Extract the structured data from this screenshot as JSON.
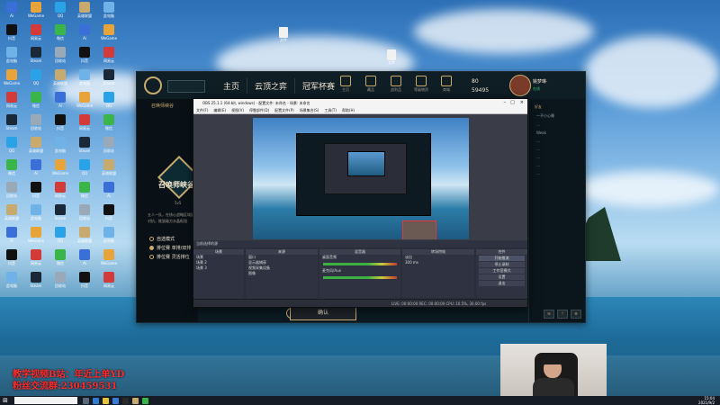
{
  "desktop": {
    "icons": [
      {
        "label": "Ai",
        "color": "#3b6fd8"
      },
      {
        "label": "抖音",
        "color": "#111111"
      },
      {
        "label": "此电脑",
        "color": "#6fb2e8"
      },
      {
        "label": "WeGame",
        "color": "#e8a43a"
      },
      {
        "label": "网易云",
        "color": "#d33a3a"
      },
      {
        "label": "Steam",
        "color": "#1b2838"
      },
      {
        "label": "QQ",
        "color": "#2aa2e8"
      },
      {
        "label": "微信",
        "color": "#3ab54a"
      },
      {
        "label": "回收站",
        "color": "#9aa9b8"
      },
      {
        "label": "英雄联盟",
        "color": "#c8aa6e"
      }
    ],
    "top_files": [
      "文件",
      "文件"
    ]
  },
  "lol": {
    "nav": [
      "主页",
      "云顶之弈",
      "冠军杯赛"
    ],
    "top_icons": [
      "主页",
      "藏品",
      "战利品",
      "等级物资",
      "商城"
    ],
    "currency": {
      "rp": "80",
      "be": "59495"
    },
    "player_name": "姚梦琳·",
    "status": "在线",
    "sub_tab": "召唤师峡谷",
    "mode_small": "5v5",
    "mode_title": "召唤师峡谷",
    "mode_desc": "五人一队，在核心战略区域展开对抗，推毁敌方水晶枢纽",
    "options": [
      {
        "label": "自选模式",
        "on": false
      },
      {
        "label": "排位赛 单排/双排",
        "on": true
      },
      {
        "label": "排位赛 灵活排位",
        "on": false
      }
    ],
    "confirm": "确认",
    "close": "×",
    "friends_header": "好友",
    "friends": [
      "一不小心睡",
      "…",
      "Weak",
      "…",
      "…",
      "…",
      "…",
      "…"
    ]
  },
  "obs": {
    "title": "OBS 25.1.1 (64-bit, windows) - 配置文件: 未命名 - 场景: 未命名",
    "menu": [
      "文件(F)",
      "编辑(E)",
      "视图(V)",
      "停靠部件(D)",
      "配置文件(P)",
      "场景集合(S)",
      "工具(T)",
      "帮助(H)"
    ],
    "scenebar": "当前选择的源",
    "docks": {
      "scenes": {
        "title": "场景",
        "items": [
          "场景",
          "场景 2",
          "场景 3"
        ]
      },
      "sources": {
        "title": "来源",
        "items": [
          "窗口",
          "显示器捕获",
          "视频采集设备",
          "图像"
        ]
      },
      "mixer": {
        "title": "混音器",
        "items": [
          "桌面音频",
          "麦克风/Aux"
        ]
      },
      "transitions": {
        "title": "转场特效",
        "items": [
          "淡出",
          "300 ms"
        ]
      },
      "controls": {
        "title": "控件",
        "items": [
          "开始推流",
          "停止录制",
          "工作室模式",
          "设置",
          "退出"
        ]
      }
    },
    "status": "LIVE: 00:00:00  REC: 00:00:00  CPU: 10.5%, 30.00 fps"
  },
  "overlay": {
    "line1": "教学视频B站：年近上单YD",
    "line2": "粉丝交流群:230459531"
  },
  "taskbar": {
    "time": "15:04",
    "date": "2021/9/2"
  }
}
